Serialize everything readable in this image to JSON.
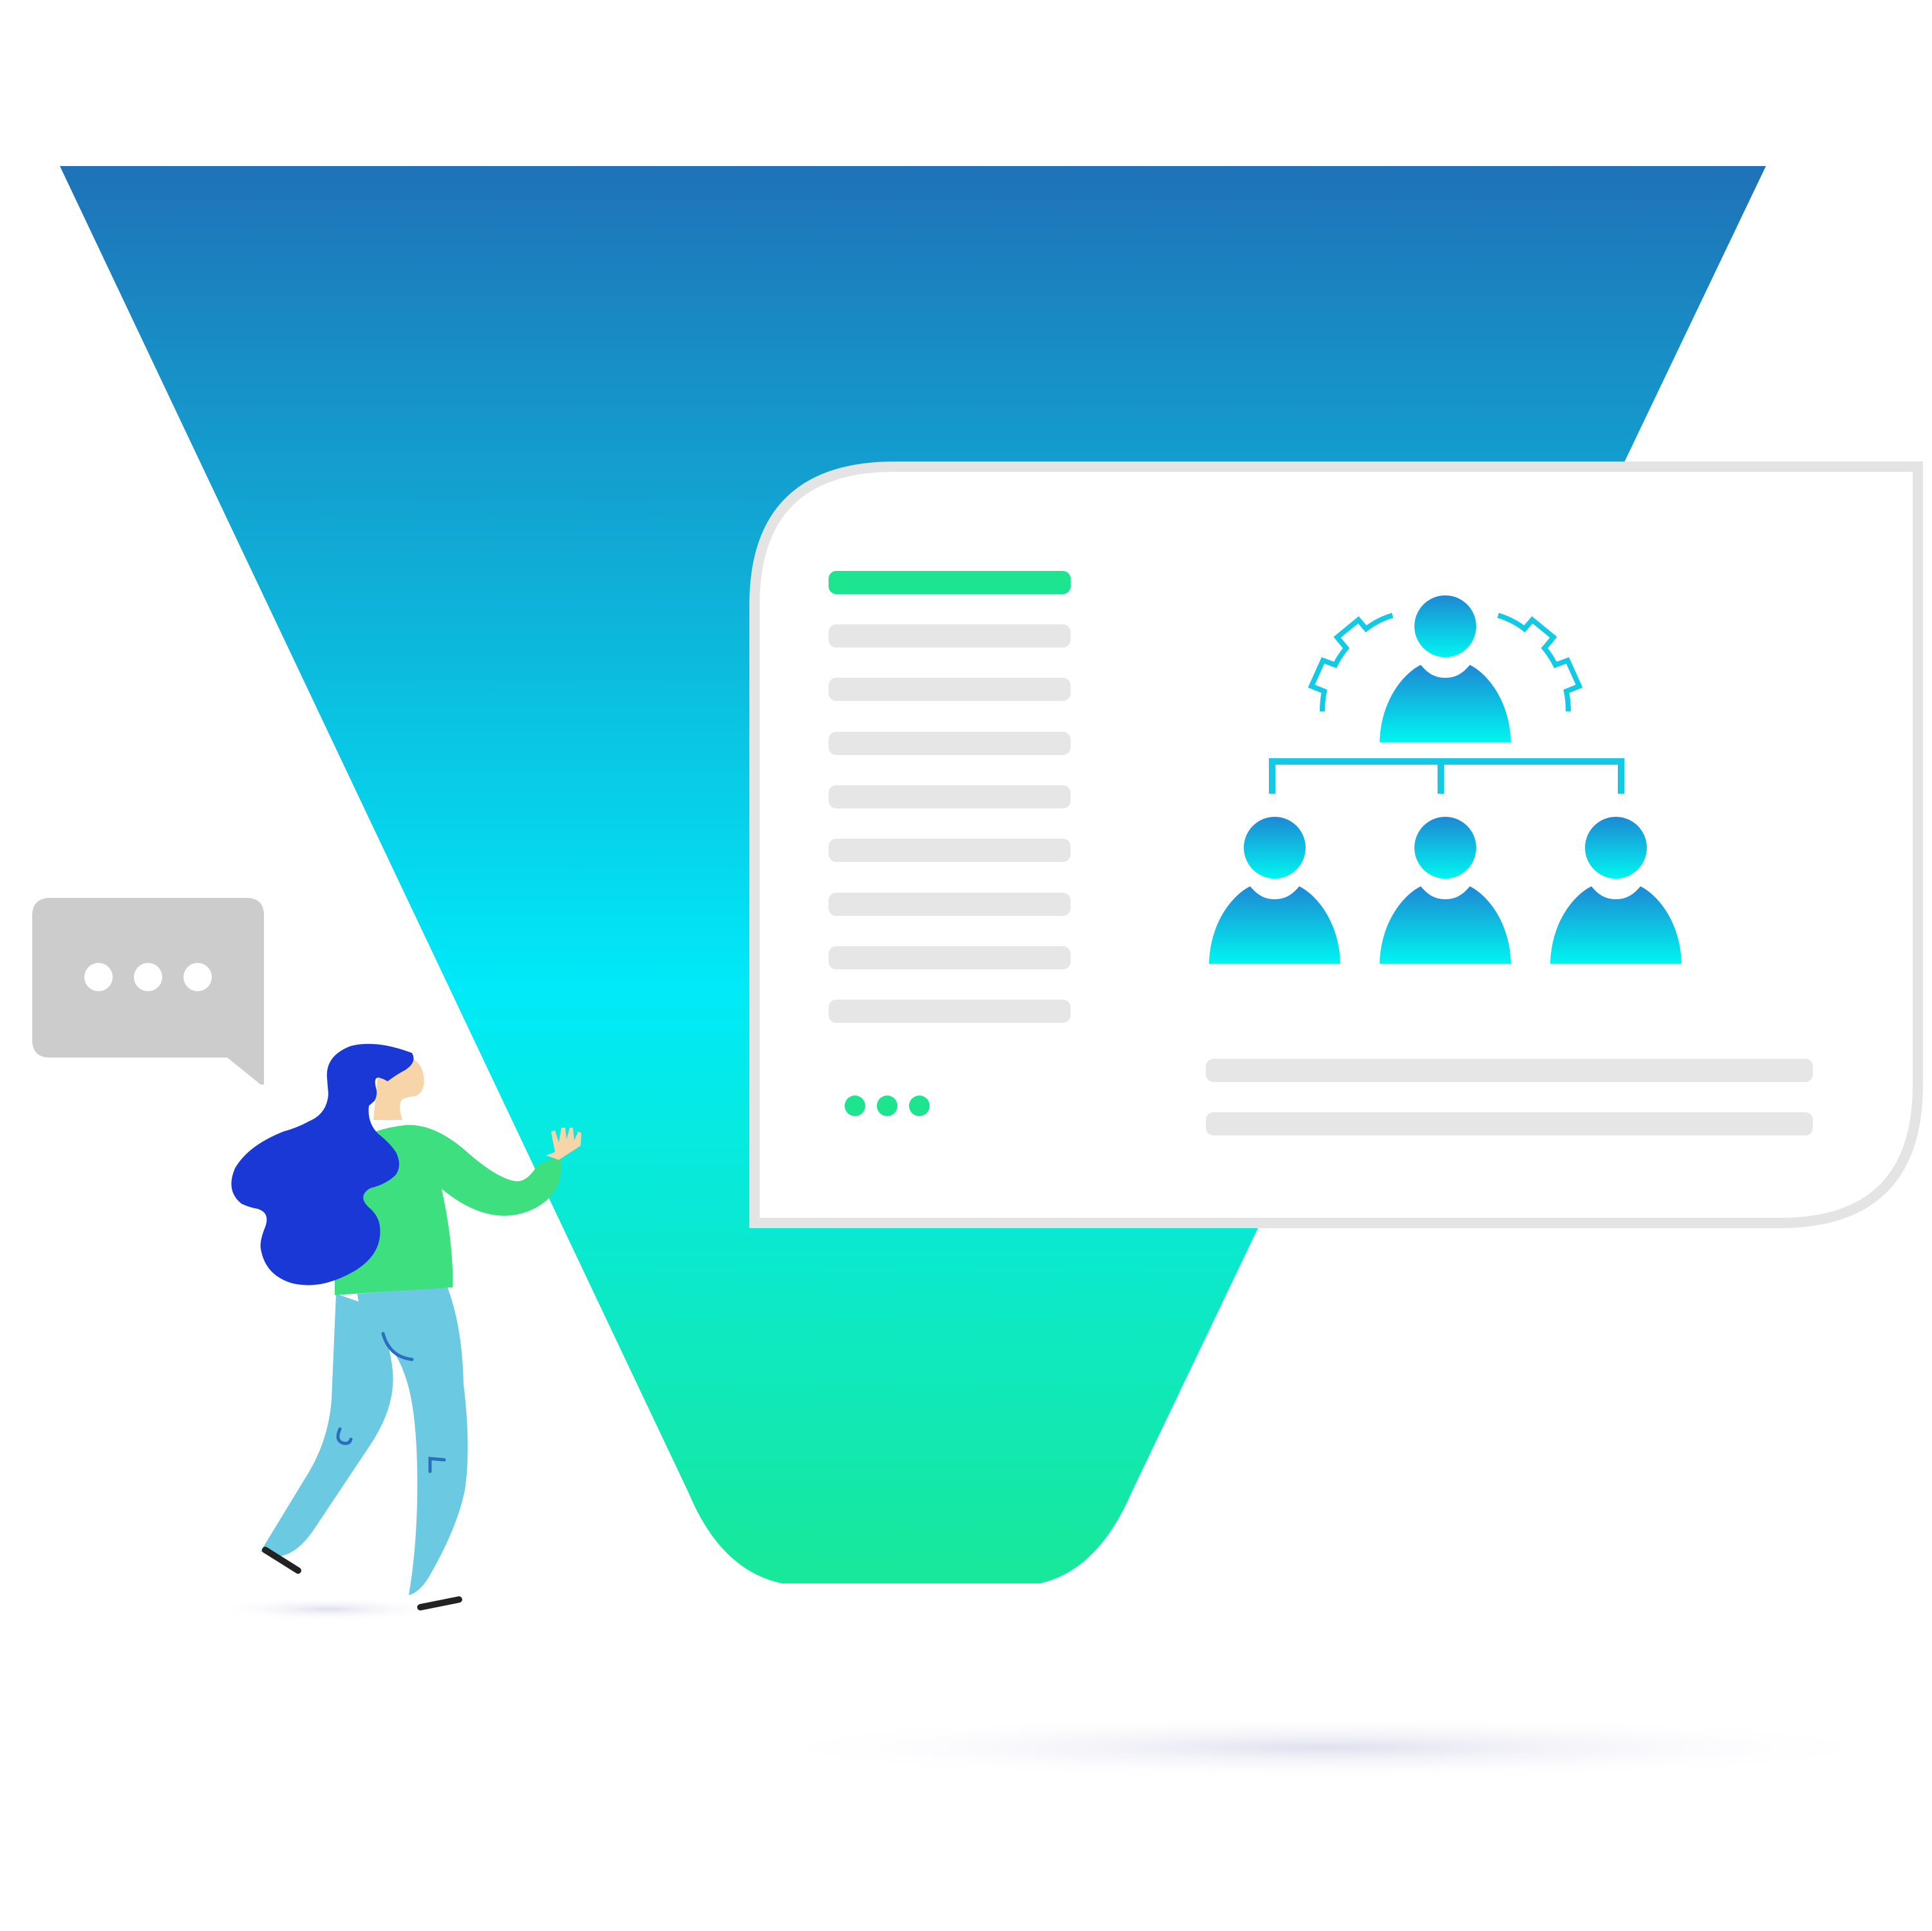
{
  "colors": {
    "background": "#ffffff",
    "funnel_top": "#1f72b7",
    "funnel_middle": "#00eaf8",
    "funnel_bottom": "#18e899",
    "panel_border": "#e4e4e4",
    "placeholder_bar": "#e6e6e6",
    "accent_green": "#1de58f",
    "org_icon_top": "#1e88d4",
    "org_icon_bottom": "#00f5f0",
    "org_line": "#12c9e6",
    "chat_bubble": "#cccccc",
    "hair": "#1a38d6",
    "shirt": "#3ddf7e",
    "pants": "#6bc9e1",
    "skin": "#f8d5a8",
    "shoe": "#222222",
    "shadow": "#e3e3ef"
  },
  "icons": {
    "chat_bubble": "speech-bubble-ellipsis-icon",
    "org_chart": "team-hierarchy-icon",
    "gear": "gear-icon",
    "dots": "ellipsis-icon"
  },
  "content": {
    "menu_item_count": 8,
    "org_chart": {
      "leaders": 1,
      "members": 3
    }
  }
}
